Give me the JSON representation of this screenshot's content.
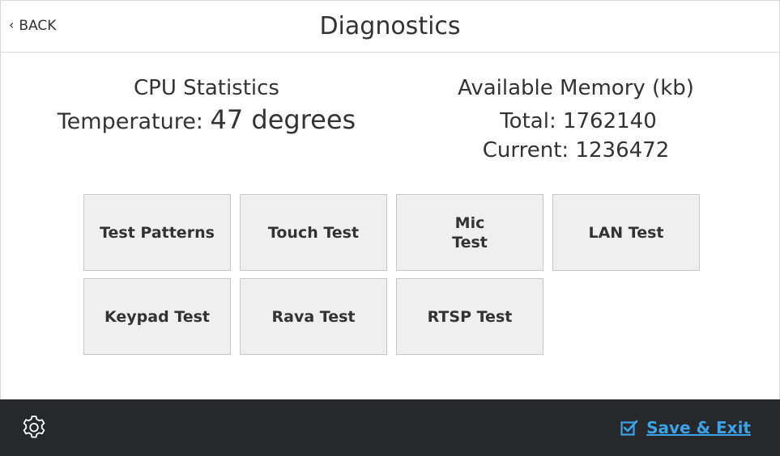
{
  "header": {
    "back_label": "BACK",
    "back_icon": "chevron-left-icon",
    "title": "Diagnostics"
  },
  "cpu": {
    "heading": "CPU Statistics",
    "temperature_label": "Temperature:",
    "temperature_value": "47 degrees"
  },
  "memory": {
    "heading": "Available Memory (kb)",
    "total_label": "Total:",
    "total_value": "1762140",
    "current_label": "Current:",
    "current_value": "1236472"
  },
  "tests": [
    {
      "label": "Test Patterns"
    },
    {
      "label": "Touch Test"
    },
    {
      "label": "Mic\nTest"
    },
    {
      "label": "LAN Test"
    },
    {
      "label": "Keypad Test"
    },
    {
      "label": "Rava Test"
    },
    {
      "label": "RTSP Test"
    }
  ],
  "footer": {
    "settings_icon": "gear-icon",
    "save_exit_icon": "checkbox-icon",
    "save_exit_label": "Save & Exit"
  },
  "colors": {
    "footer_bg": "#26282b",
    "accent": "#3aa3e8",
    "tile_bg": "#efefef"
  }
}
